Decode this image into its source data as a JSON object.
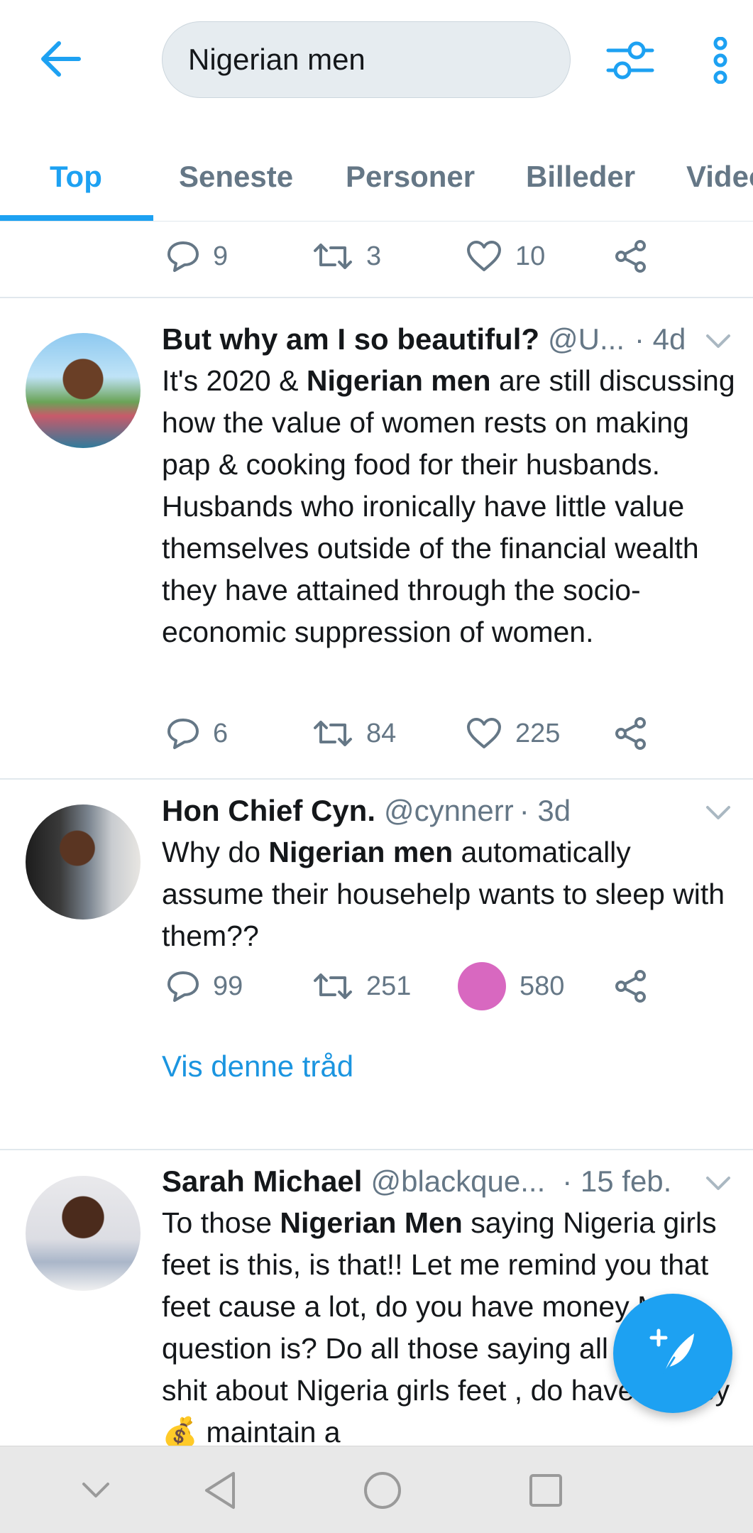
{
  "search": {
    "value": "Nigerian men"
  },
  "tabs": [
    {
      "label": "Top",
      "active": true
    },
    {
      "label": "Seneste",
      "active": false
    },
    {
      "label": "Personer",
      "active": false
    },
    {
      "label": "Billeder",
      "active": false
    },
    {
      "label": "Videoer",
      "active": false
    }
  ],
  "partial_tweet": {
    "replies": "9",
    "retweets": "3",
    "likes": "10"
  },
  "tweets": [
    {
      "name": "But why am I so beautiful?",
      "handle": "@U...",
      "time": "· 4d",
      "text_parts": [
        "It's 2020 & ",
        "Nigerian men",
        " are still discussing how the value of women rests on making pap & cooking food for their husbands. Husbands who ironically have little value themselves outside of the financial wealth they have attained through the socio-economic suppression of women."
      ],
      "replies": "6",
      "retweets": "84",
      "likes": "225"
    },
    {
      "name": "Hon Chief Cyn.",
      "handle": "@cynnerr",
      "time": "· 3d",
      "text_parts": [
        "Why do ",
        "Nigerian men",
        " automatically assume their househelp wants to sleep with them??"
      ],
      "replies": "99",
      "retweets": "251",
      "likes": "580",
      "thread_link": "Vis denne tråd"
    },
    {
      "name": "Sarah Michael",
      "handle": "@blackque...",
      "time": "· 15 feb.",
      "text_parts": [
        "To those ",
        "Nigerian Men",
        " saying Nigeria girls feet is this, is that!!  Let me remind you that feet cause a lot, do you have money My question is? Do all those saying all sort of shit about Nigeria girls feet , do have money 💰 maintain a"
      ]
    }
  ],
  "colors": {
    "accent": "#1da1f2",
    "secondary_text": "#657786",
    "like_badge": "#d868c0"
  },
  "icons": [
    "back-arrow-icon",
    "filter-icon",
    "more-vertical-icon",
    "reply-icon",
    "retweet-icon",
    "like-icon",
    "share-icon",
    "caret-down-icon",
    "compose-icon",
    "nav-down-icon",
    "nav-back-icon",
    "nav-home-icon",
    "nav-recents-icon"
  ]
}
